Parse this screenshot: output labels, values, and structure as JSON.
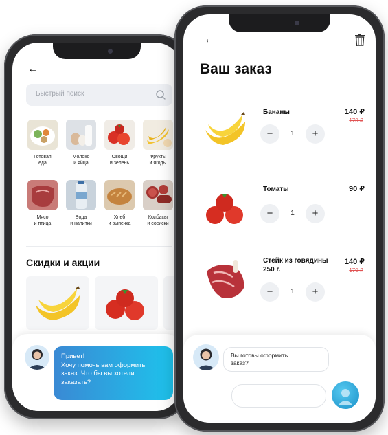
{
  "catalog": {
    "search_placeholder": "Быстрый поиск",
    "categories": [
      {
        "label": "Готовая\nеда"
      },
      {
        "label": "Молоко\nи яйца"
      },
      {
        "label": "Овощи\nи зелень"
      },
      {
        "label": "Фрукты\nи ягоды"
      },
      {
        "label": "Мясо\nи птица"
      },
      {
        "label": "Вода\nи напитки"
      },
      {
        "label": "Хлеб\nи выпечка"
      },
      {
        "label": "Колбасы\nи сосиски"
      }
    ],
    "promo_title": "Скидки и акции",
    "chat_message": "Привет!\nХочу помочь вам оформить\nзаказ. Что бы вы хотели\nзаказать?"
  },
  "order": {
    "title": "Ваш заказ",
    "items": [
      {
        "name": "Бананы",
        "price": "140 ₽",
        "old_price": "170 ₽",
        "qty": "1"
      },
      {
        "name": "Томаты",
        "price": "90 ₽",
        "qty": "1"
      },
      {
        "name": "Стейк из говядины\n250 г.",
        "price": "140 ₽",
        "old_price": "170 ₽",
        "qty": "1"
      }
    ],
    "chat_message": "Вы готовы оформить\nзаказ?"
  },
  "icons": {
    "back": "arrow-left-icon",
    "search": "search-icon",
    "trash": "trash-icon",
    "mic": "assistant-icon"
  },
  "colors": {
    "accent_gradient_start": "#3a89d4",
    "accent_gradient_end": "#1ec3ec",
    "old_price": "#e05353"
  }
}
